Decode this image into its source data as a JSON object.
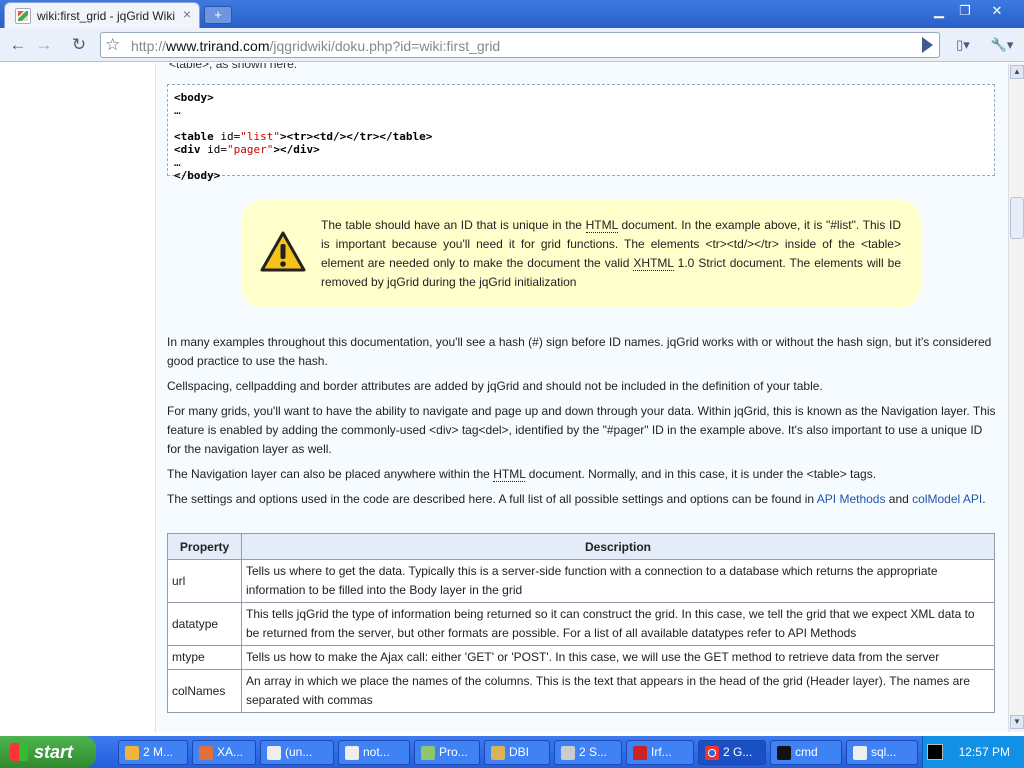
{
  "browser": {
    "tab_title": "wiki:first_grid - jqGrid Wiki",
    "tab_close": "×",
    "new_tab": "+",
    "window_controls": {
      "minimize": "▁",
      "maximize": "❐",
      "close": "✕"
    },
    "nav": {
      "back": "←",
      "forward": "→",
      "reload": "↻",
      "page_menu": "▯▾",
      "tools_menu": "🔧▾"
    },
    "url_prefix": "http://",
    "url_domain": "www.trirand.com",
    "url_path": "/jqgridwiki/doku.php?id=wiki:first_grid"
  },
  "article": {
    "cut_text": "<table>, as shown here:",
    "code_lines": [
      {
        "kw": "<body>",
        "rest": ""
      },
      {
        "kw": "…",
        "rest": ""
      },
      {
        "kw": "",
        "rest": ""
      },
      {
        "kw": "<div",
        "rest": ""
      },
      {
        "kw": "…",
        "rest": ""
      },
      {
        "kw": "</body>",
        "rest": ""
      }
    ],
    "code_table_line": {
      "open": "<table",
      "attr": " id=",
      "val": "\"list\"",
      "mid": "><",
      "tr": "tr",
      "gt": "><",
      "td": "td",
      "end": "/></",
      "tr2": "tr",
      "gt2": "></",
      "table": "table",
      "close": ">"
    },
    "code_div_line": {
      "open": "<div",
      "attr": " id=",
      "val": "\"pager\"",
      "end": "></",
      "div": "div",
      "close": ">"
    },
    "note": {
      "p1": "The table should have an ID that is unique in the ",
      "html": "HTML",
      "p2": " document. In the example above, it is \"#list\". This ID is important because you'll need it for grid functions. The elements <tr><td/></tr> inside of the <table> element are needed only to make the document the valid ",
      "xhtml": "XHTML",
      "p3": " 1.0 Strict document. The elements will be removed by jqGrid during the jqGrid initialization"
    },
    "para1": "In many examples throughout this documentation, you'll see a hash (#) sign before ID names. jqGrid works with or without the hash sign, but it's considered good practice to use the hash.",
    "para2": "Cellspacing, cellpadding and border attributes are added by jqGrid and should not be included in the definition of your table.",
    "para3": "For many grids, you'll want to have the ability to navigate and page up and down through your data. Within jqGrid, this is known as the Navigation layer. This feature is enabled by adding the commonly-used <div> tag<del>, identified by the \"#pager\" ID in the example above. It's also important to use a unique ID for the navigation layer as well.",
    "para4_a": "The Navigation layer can also be placed anywhere within the ",
    "para4_html": "HTML",
    "para4_b": " document. Normally, and in this case, it is under the <table> tags.",
    "para5_a": "The settings and options used in the code are described here. A full list of all possible settings and options can be found in ",
    "para5_link1": "API Methods",
    "para5_b": " and ",
    "para5_link2": "colModel API",
    "para5_c": ".",
    "table": {
      "headers": [
        "Property",
        "Description"
      ],
      "rows": [
        {
          "prop": "url",
          "desc": "Tells us where to get the data. Typically this is a server-side function with a connection to a database which returns the appropriate information to be filled into the Body layer in the grid"
        },
        {
          "prop": "datatype",
          "desc": "This tells jqGrid the type of information being returned so it can construct the grid. In this case, we tell the grid that we expect XML data to be returned from the server, but other formats are possible. For a list of all available datatypes refer to API Methods"
        },
        {
          "prop": "mtype",
          "desc": "Tells us how to make the Ajax call: either 'GET' or 'POST'. In this case, we will use the GET method to retrieve data from the server"
        },
        {
          "prop": "colNames",
          "desc": "An array in which we place the names of the columns. This is the text that appears in the head of the grid (Header layer). The names are separated with commas"
        }
      ]
    }
  },
  "taskbar": {
    "start": "start",
    "tasks": [
      "2 M...",
      "XA...",
      "(un...",
      "not...",
      "Pro...",
      "DBI",
      "2 S...",
      "Irf...",
      "2 G...",
      "cmd",
      "sql..."
    ],
    "tray_toggle": "‹",
    "clock": "12:57 PM"
  }
}
